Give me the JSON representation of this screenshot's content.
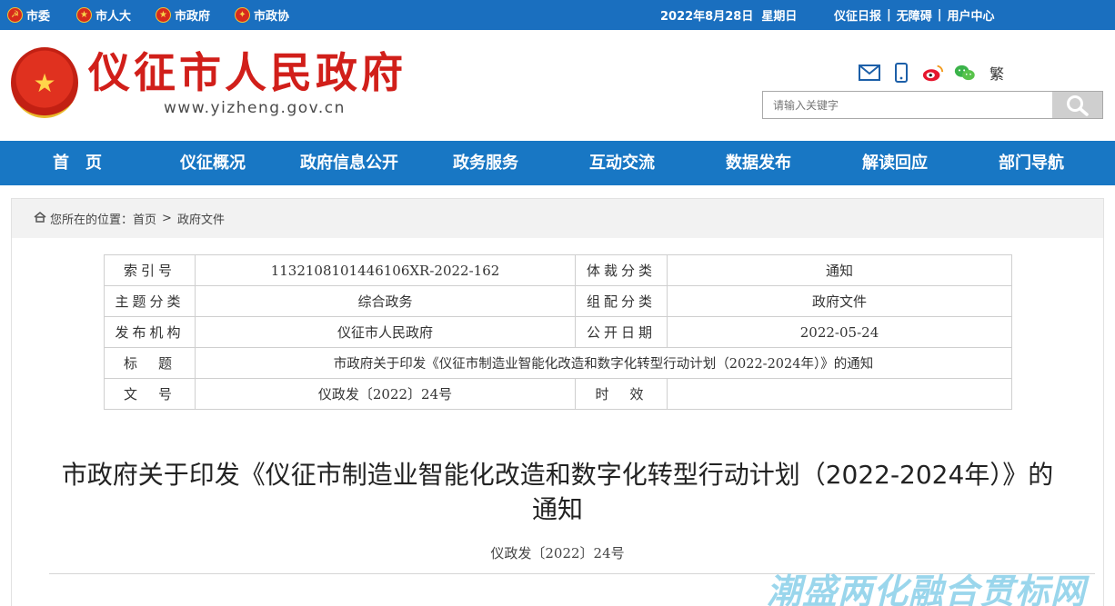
{
  "topbar": {
    "links": [
      "市委",
      "市人大",
      "市政府",
      "市政协"
    ],
    "date": "2022年8月28日",
    "weekday": "星期日",
    "right_links": [
      "仪征日报",
      "无障碍",
      "用户中心"
    ]
  },
  "header": {
    "site_title": "仪征市人民政府",
    "site_url": "www.yizheng.gov.cn",
    "traditional_label": "繁",
    "search_placeholder": "请输入关键字"
  },
  "nav": {
    "items": [
      "首　页",
      "仪征概况",
      "政府信息公开",
      "政务服务",
      "互动交流",
      "数据发布",
      "解读回应",
      "部门导航"
    ]
  },
  "breadcrumb": {
    "prefix": "您所在的位置：",
    "home": "首页",
    "separator": ">",
    "current": "政府文件"
  },
  "meta": {
    "index_label": "索引号",
    "index_value": "1132108101446106XR-2022-162",
    "genre_label": "体裁分类",
    "genre_value": "通知",
    "topic_label": "主题分类",
    "topic_value": "综合政务",
    "group_label": "组配分类",
    "group_value": "政府文件",
    "publisher_label": "发布机构",
    "publisher_value": "仪征市人民政府",
    "date_label": "公开日期",
    "date_value": "2022-05-24",
    "title_label": "标　题",
    "title_value": "市政府关于印发《仪征市制造业智能化改造和数字化转型行动计划（2022-2024年）》的通知",
    "docno_label": "文　号",
    "docno_value": "仪政发〔2022〕24号",
    "validity_label": "时　效",
    "validity_value": ""
  },
  "document": {
    "title_line1": "市政府关于印发《仪征市制造业智能化改造和数字化转型行动计划（2022-2024年）》的",
    "title_line2": "通知",
    "number": "仪政发〔2022〕24号"
  },
  "watermark": "潮盛两化融合贯标网",
  "colors": {
    "topbar": "#1a6fbf",
    "nav": "#1877c4",
    "title_red": "#d11f1a"
  }
}
